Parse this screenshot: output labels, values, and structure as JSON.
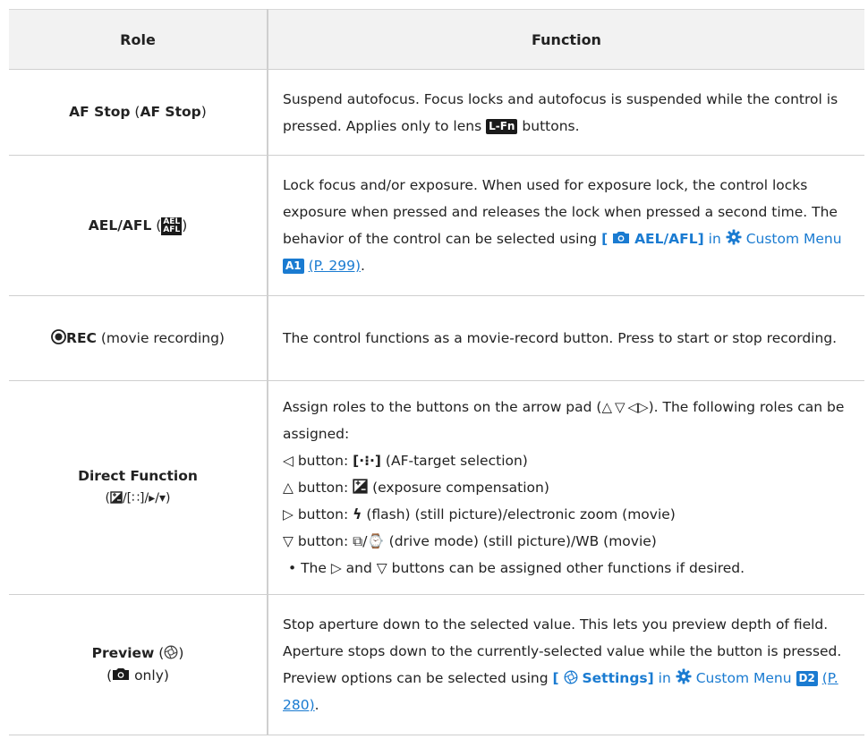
{
  "header": {
    "role": "Role",
    "function": "Function"
  },
  "rows": {
    "af_stop": {
      "role_name": "AF Stop",
      "role_name_paren": "AF Stop",
      "func_text": "Suspend autofocus. Focus locks and autofocus is suspended while the control is pressed. Applies only to lens",
      "lfn_label": "L-Fn",
      "func_tail": "buttons."
    },
    "ael_afl": {
      "role_name": "AEL/AFL",
      "badge_top": "AEL",
      "badge_bottom": "AFL",
      "func_text": "Lock focus and/or exposure. When used for exposure lock, the control locks exposure when pressed and releases the lock when pressed a second time. The behavior of the control can be selected using",
      "link_bracket_open": "[",
      "link_label": "AEL/AFL]",
      "in": "in",
      "menu": "Custom Menu",
      "menu_badge": "A1",
      "page": "(P. 299)",
      "end": "."
    },
    "rec": {
      "role_name": "REC",
      "role_desc": "(movie recording)",
      "func_text": "The control functions as a movie-record button. Press to start or stop recording."
    },
    "direct": {
      "role_name": "Direct Function",
      "role_sub": "/[∷]/▸/▾",
      "line1": "Assign roles to the buttons on the arrow pad (",
      "arrows": "△ ▽ ◁▷",
      "line1_end": "). The following roles can be assigned:",
      "l_left": "◁ button:",
      "l_left_icon": "[·⁝·]",
      "l_left_desc": "(AF-target selection)",
      "l_up": "△ button:",
      "l_up_desc": "(exposure compensation)",
      "l_right": "▷ button:",
      "l_right_icon": "ϟ",
      "l_right_desc": "(flash) (still picture)/electronic zoom (movie)",
      "l_down": "▽ button:",
      "l_down_icon": "⧉/⌚",
      "l_down_desc": "(drive mode) (still picture)/WB (movie)",
      "bullet": "• The ▷ and ▽ buttons can be assigned other functions if desired."
    },
    "preview": {
      "role_name": "Preview",
      "role_only": "only)",
      "func_text": "Stop aperture down to the selected value. This lets you preview depth of field. Aperture stops down to the currently-selected value while the button is pressed. Preview options can be selected using",
      "link_bracket_open": "[",
      "link_label": "Settings]",
      "in": "in",
      "menu": "Custom Menu",
      "menu_badge": "D2",
      "page": "(P. 280)",
      "end": "."
    }
  },
  "colors": {
    "link": "#1a7bd1",
    "header_bg": "#f2f2f2",
    "border": "#cfcfcf"
  },
  "icons": [
    "lens-fn-icon",
    "ael-afl-icon",
    "camera-icon",
    "gear-icon",
    "record-icon",
    "aperture-preview-icon",
    "exposure-compensation-icon",
    "af-target-icon",
    "flash-icon",
    "drive-mode-icon"
  ]
}
